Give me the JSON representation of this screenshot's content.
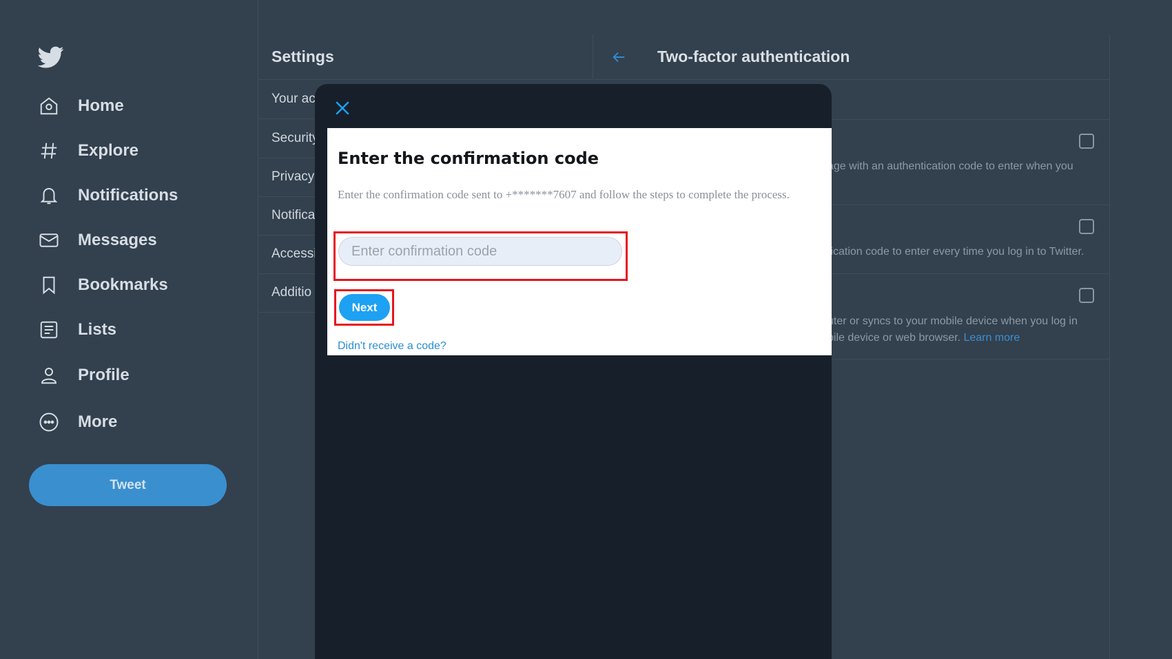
{
  "nav": {
    "items": [
      {
        "label": "Home",
        "icon": "home-icon"
      },
      {
        "label": "Explore",
        "icon": "hashtag-icon"
      },
      {
        "label": "Notifications",
        "icon": "bell-icon"
      },
      {
        "label": "Messages",
        "icon": "envelope-icon"
      },
      {
        "label": "Bookmarks",
        "icon": "bookmark-icon"
      },
      {
        "label": "Lists",
        "icon": "list-icon"
      },
      {
        "label": "Profile",
        "icon": "person-icon"
      },
      {
        "label": "More",
        "icon": "more-icon"
      }
    ],
    "tweet_label": "Tweet"
  },
  "settings": {
    "title": "Settings",
    "items": [
      "Your acc",
      "Security",
      "Privacy",
      "Notifica",
      "Accessil",
      "Additio"
    ]
  },
  "tfa": {
    "title": "Two-factor authentication",
    "options": [
      {
        "desc_line1": "age with an authentication code to enter when you",
        "desc_line2": ""
      },
      {
        "desc_line1": "fication code to enter every time you log in to Twitter.",
        "desc_line2": ""
      },
      {
        "desc_line1": "uter or syncs to your mobile device when you log in",
        "desc_line2": "bile device or web browser.",
        "link": "Learn more"
      }
    ]
  },
  "modal": {
    "heading": "Enter the confirmation code",
    "instructions": "Enter the confirmation code sent to +*******7607 and follow the steps to complete the process.",
    "input_placeholder": "Enter confirmation code",
    "input_value": "",
    "next_label": "Next",
    "resend_label": "Didn't receive a code?"
  },
  "colors": {
    "background": "#33404e",
    "modal_bg": "#17202a",
    "accent": "#1da1f2",
    "highlight": "#e8141c"
  }
}
